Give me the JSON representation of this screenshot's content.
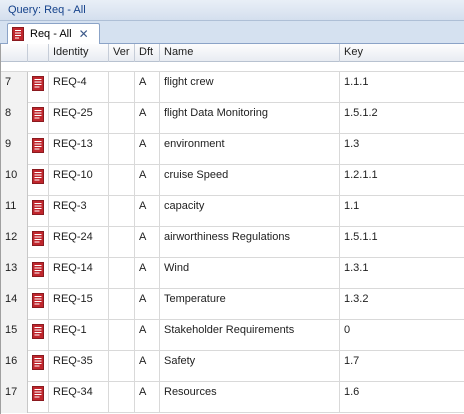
{
  "window": {
    "title": "Query: Req - All"
  },
  "tab": {
    "label": "Req - All",
    "close": "✕"
  },
  "columns": [
    "Identity",
    "Ver",
    "Dft",
    "Name",
    "Key"
  ],
  "rows": [
    {
      "num": "7",
      "id": "REQ-4",
      "ver": "",
      "dft": "A",
      "name": "flight crew",
      "key": "1.1.1"
    },
    {
      "num": "8",
      "id": "REQ-25",
      "ver": "",
      "dft": "A",
      "name": "flight Data Monitoring",
      "key": "1.5.1.2"
    },
    {
      "num": "9",
      "id": "REQ-13",
      "ver": "",
      "dft": "A",
      "name": "environment",
      "key": "1.3"
    },
    {
      "num": "10",
      "id": "REQ-10",
      "ver": "",
      "dft": "A",
      "name": "cruise Speed",
      "key": "1.2.1.1"
    },
    {
      "num": "11",
      "id": "REQ-3",
      "ver": "",
      "dft": "A",
      "name": "capacity",
      "key": "1.1"
    },
    {
      "num": "12",
      "id": "REQ-24",
      "ver": "",
      "dft": "A",
      "name": "airworthiness Regulations",
      "key": "1.5.1.1"
    },
    {
      "num": "13",
      "id": "REQ-14",
      "ver": "",
      "dft": "A",
      "name": "Wind",
      "key": "1.3.1"
    },
    {
      "num": "14",
      "id": "REQ-15",
      "ver": "",
      "dft": "A",
      "name": "Temperature",
      "key": "1.3.2"
    },
    {
      "num": "15",
      "id": "REQ-1",
      "ver": "",
      "dft": "A",
      "name": "Stakeholder Requirements",
      "key": "0"
    },
    {
      "num": "16",
      "id": "REQ-35",
      "ver": "",
      "dft": "A",
      "name": "Safety",
      "key": "1.7"
    },
    {
      "num": "17",
      "id": "REQ-34",
      "ver": "",
      "dft": "A",
      "name": "Resources",
      "key": "1.6"
    }
  ],
  "icons": {
    "row": "requirement-document-icon",
    "tab": "requirement-document-icon"
  },
  "colors": {
    "icon_red": "#c0262d",
    "header_blue": "#15428b"
  }
}
